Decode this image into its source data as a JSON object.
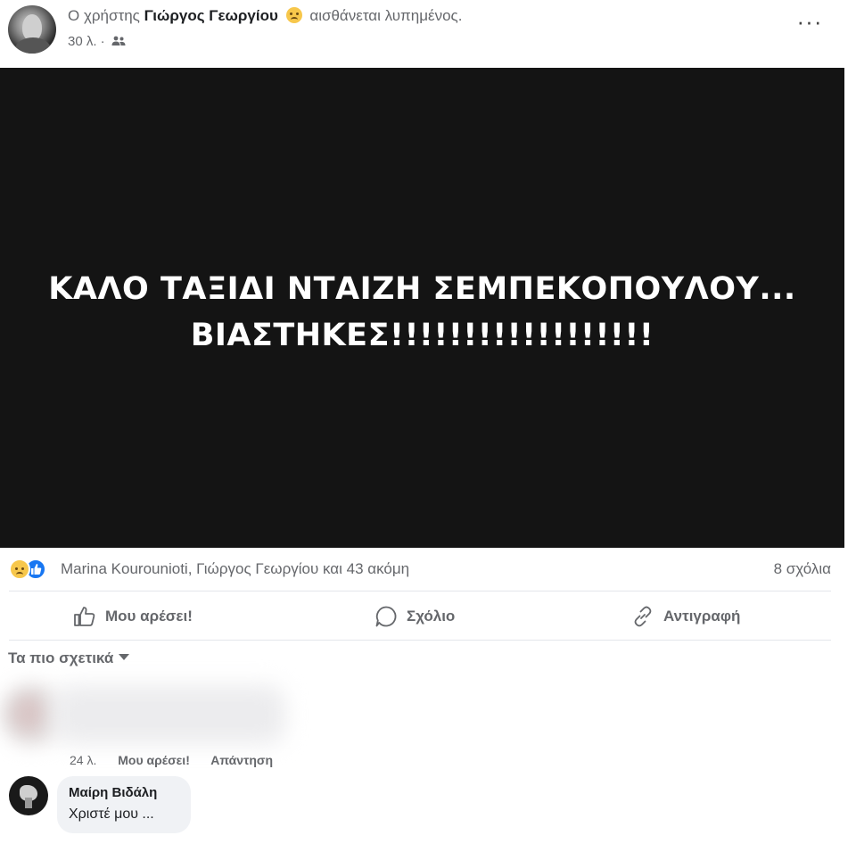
{
  "post": {
    "status_prefix": "Ο χρήστης",
    "author": "Γιώργος Γεωργίου",
    "feeling": "αισθάνεται λυπημένος.",
    "time": "30 λ. ·",
    "more_label": "···",
    "image_line1": "ΚΑΛΟ ΤΑΞΙΔΙ ΝΤΑΙΖΗ ΣΕΜΠΕΚΟΠΟΥΛΟΥ...",
    "image_line2": "ΒΙΑΣΤΗΚΕΣ!!!!!!!!!!!!!!!!!!"
  },
  "reactions": {
    "summary": "Marina Kourounioti, Γιώργος Γεωργίου και 43 ακόμη",
    "comments": "8 σχόλια"
  },
  "actions": {
    "like": "Μου αρέσει!",
    "comment": "Σχόλιο",
    "copy": "Αντιγραφή"
  },
  "comments": {
    "sort_label": "Τα πιο σχετικά",
    "first": {
      "time": "24 λ.",
      "like": "Μου αρέσει!",
      "reply": "Απάντηση"
    },
    "second": {
      "author": "Μαίρη Βιδάλη",
      "text": "Χριστέ μου ..."
    }
  },
  "colors": {
    "image_background": "#141414",
    "like_blue": "#1877f2",
    "secondary_text": "#65676b"
  }
}
